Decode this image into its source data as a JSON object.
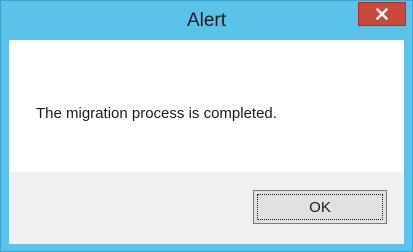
{
  "window": {
    "title": "Alert",
    "close_icon": "close-icon",
    "accent_color": "#5bc3ea",
    "close_color": "#c9483a"
  },
  "dialog": {
    "message": "The migration process is completed.",
    "ok_label": "OK"
  }
}
